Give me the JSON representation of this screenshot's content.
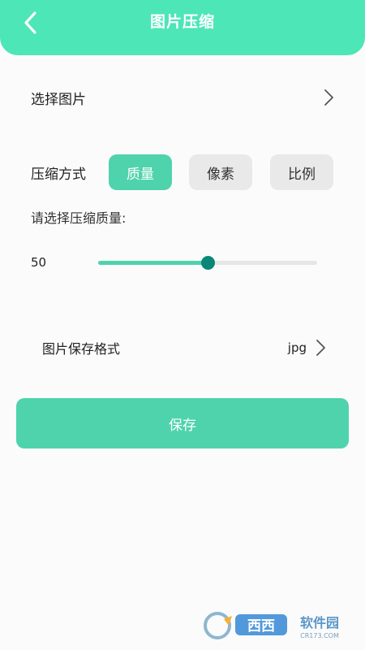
{
  "header": {
    "title": "图片压缩",
    "back_icon": "chevron-left-icon"
  },
  "select_image": {
    "label": "选择图片",
    "icon": "chevron-right-icon"
  },
  "compress": {
    "label": "压缩方式",
    "modes": [
      {
        "label": "质量",
        "active": true
      },
      {
        "label": "像素",
        "active": false
      },
      {
        "label": "比例",
        "active": false
      }
    ]
  },
  "quality": {
    "label": "请选择压缩质量:",
    "value": "50",
    "min": 0,
    "max": 100
  },
  "format": {
    "label": "图片保存格式",
    "value": "jpg",
    "icon": "chevron-right-icon"
  },
  "save": {
    "label": "保存"
  },
  "watermark": {
    "brand_text": "西西软件园",
    "domain_text": "CR173.COM"
  },
  "colors": {
    "header": "#4de6b6",
    "accent": "#4fd3ac",
    "thumb": "#0b8777",
    "background": "#fbfbfb"
  }
}
